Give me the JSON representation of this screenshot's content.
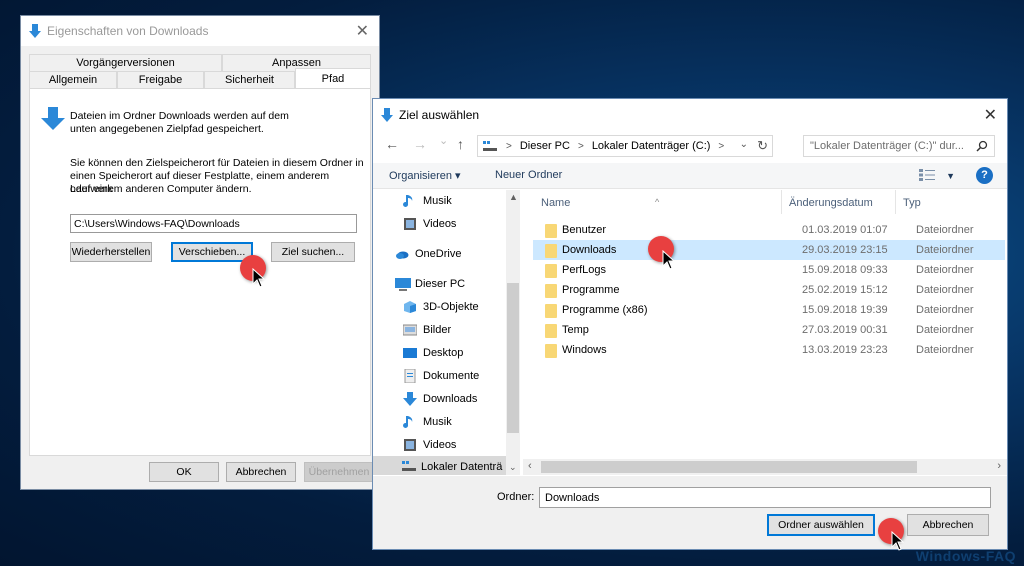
{
  "properties_dialog": {
    "title": "Eigenschaften von Downloads",
    "close_label": "✕",
    "tabs_row1": [
      "Vorgängerversionen",
      "Anpassen"
    ],
    "tabs_row2": [
      "Allgemein",
      "Freigabe",
      "Sicherheit",
      "Pfad"
    ],
    "active_tab": "Pfad",
    "info_line1": "Dateien im Ordner Downloads werden auf dem",
    "info_line2": "unten angegebenen Zielpfad gespeichert.",
    "desc_line1": "Sie können den Zielspeicherort für Dateien in diesem Ordner in",
    "desc_line2": "einen Speicherort auf dieser Festplatte, einem anderem Laufwerk",
    "desc_line3": "oder einem anderen Computer ändern.",
    "path_value": "C:\\Users\\Windows-FAQ\\Downloads",
    "buttons": {
      "restore": "Wiederherstellen",
      "move": "Verschieben...",
      "find_target": "Ziel suchen...",
      "ok": "OK",
      "cancel": "Abbrechen",
      "apply": "Übernehmen"
    }
  },
  "folder_picker": {
    "title": "Ziel auswählen",
    "close_label": "✕",
    "nav": {
      "back": "←",
      "forward": "→",
      "recent": "⌄",
      "up": "↑",
      "breadcrumb": [
        "Dieser PC",
        "Lokaler Datenträger (C:)"
      ],
      "refresh": "↻"
    },
    "search_placeholder": "\"Lokaler Datenträger (C:)\" dur...",
    "toolbar": {
      "organize": "Organisieren ▾",
      "new_folder": "Neuer Ordner",
      "help": "?"
    },
    "nav_pane": [
      {
        "label": "Musik",
        "icon": "music-icon"
      },
      {
        "label": "Videos",
        "icon": "videos-icon"
      },
      {
        "label": "OneDrive",
        "icon": "onedrive-icon"
      },
      {
        "label": "Dieser PC",
        "icon": "this-pc-icon"
      },
      {
        "label": "3D-Objekte",
        "icon": "3d-objects-icon"
      },
      {
        "label": "Bilder",
        "icon": "pictures-icon"
      },
      {
        "label": "Desktop",
        "icon": "desktop-icon"
      },
      {
        "label": "Dokumente",
        "icon": "documents-icon"
      },
      {
        "label": "Downloads",
        "icon": "downloads-icon"
      },
      {
        "label": "Musik",
        "icon": "music-icon"
      },
      {
        "label": "Videos",
        "icon": "videos-icon"
      },
      {
        "label": "Lokaler Datenträ",
        "icon": "drive-icon"
      }
    ],
    "columns": [
      "Name",
      "Änderungsdatum",
      "Typ"
    ],
    "files": [
      {
        "name": "Benutzer",
        "date": "01.03.2019 01:07",
        "type": "Dateiordner"
      },
      {
        "name": "Downloads",
        "date": "29.03.2019 23:15",
        "type": "Dateiordner"
      },
      {
        "name": "PerfLogs",
        "date": "15.09.2018 09:33",
        "type": "Dateiordner"
      },
      {
        "name": "Programme",
        "date": "25.02.2019 15:12",
        "type": "Dateiordner"
      },
      {
        "name": "Programme (x86)",
        "date": "15.09.2018 19:39",
        "type": "Dateiordner"
      },
      {
        "name": "Temp",
        "date": "27.03.2019 00:31",
        "type": "Dateiordner"
      },
      {
        "name": "Windows",
        "date": "13.03.2019 23:23",
        "type": "Dateiordner"
      }
    ],
    "selected_file": "Downloads",
    "folder_label": "Ordner:",
    "folder_value": "Downloads",
    "buttons": {
      "select_folder": "Ordner auswählen",
      "cancel": "Abbrechen"
    }
  },
  "watermark": "Windows-FAQ",
  "colors": {
    "accent": "#0078d7",
    "selection": "#cce8ff",
    "folder": "#f8d775",
    "click_marker": "#e84040"
  }
}
